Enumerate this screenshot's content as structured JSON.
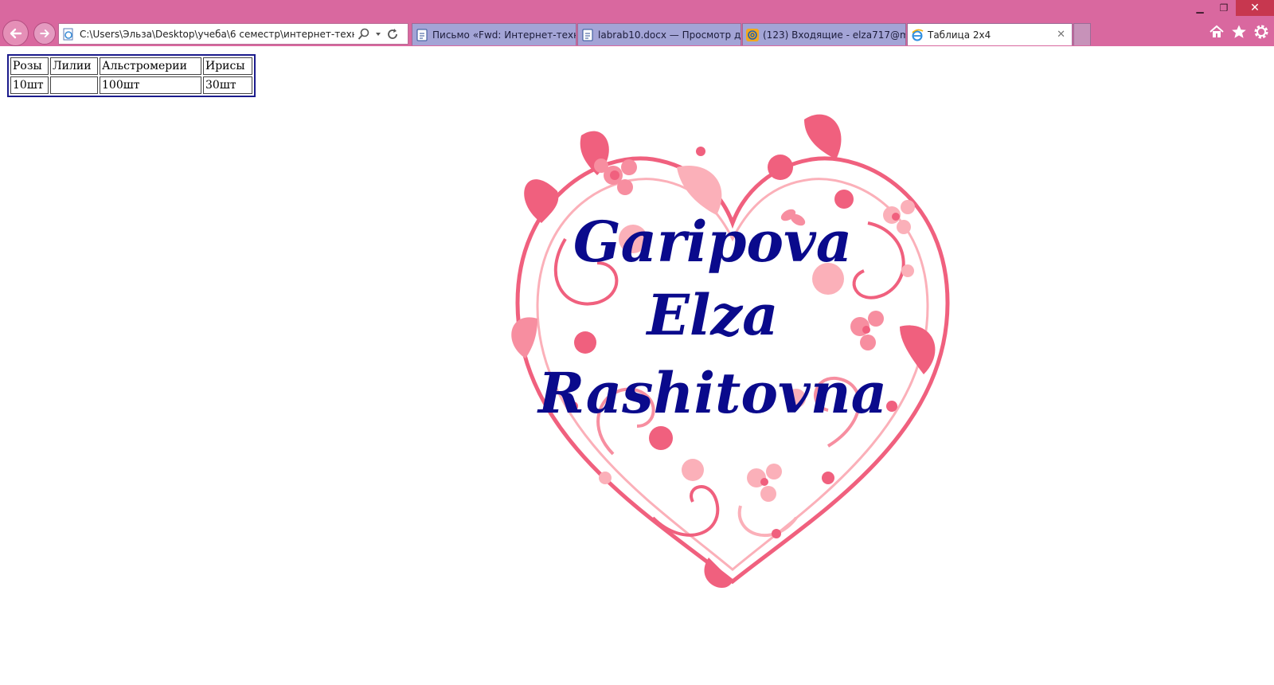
{
  "browser": {
    "address_bar": {
      "url": "C:\\Users\\Эльза\\Desktop\\учеба\\6 семестр\\интернет-техноло"
    },
    "tabs": [
      {
        "label": "Письмо «Fwd: Интернет-техн...",
        "icon": "document-icon",
        "active": false
      },
      {
        "label": "labrab10.docx — Просмотр д...",
        "icon": "document-icon",
        "active": false
      },
      {
        "label": "(123) Входящие - elza717@m...",
        "icon": "mail-at-icon",
        "active": false
      },
      {
        "label": "Таблица 2x4",
        "icon": "ie-icon",
        "active": true
      }
    ],
    "close_tab_symbol": "✕"
  },
  "table": {
    "rows": [
      [
        "Розы",
        "Лилии",
        "Альстромерии",
        "Ирисы"
      ],
      [
        "10шт",
        "",
        "100шт",
        "30шт"
      ]
    ]
  },
  "heart_image": {
    "lines": [
      "Garipova",
      "Elza",
      "Rashitovna"
    ],
    "text_color": "#0a0a8c",
    "ornament_colors": [
      "#f0607e",
      "#fbb0b9",
      "#f78ea0"
    ]
  }
}
